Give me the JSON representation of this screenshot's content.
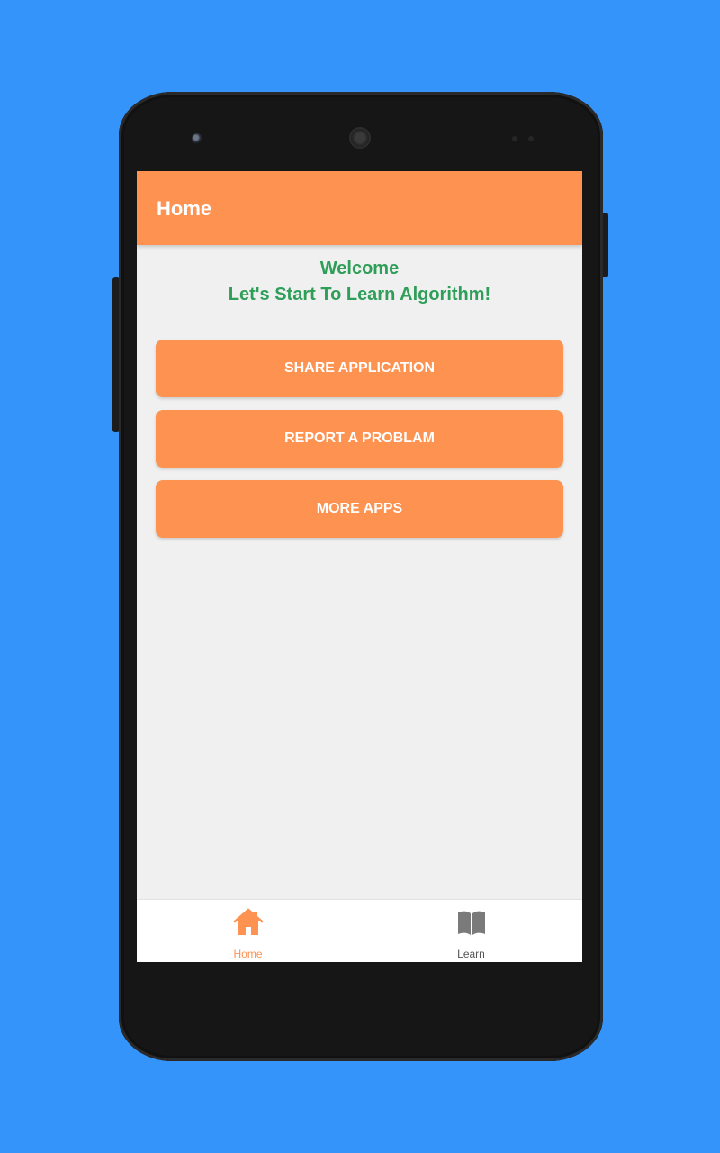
{
  "app": {
    "title": "Home"
  },
  "main": {
    "welcome_line1": "Welcome",
    "welcome_line2": "Let's Start To Learn Algorithm!",
    "buttons": [
      {
        "label": "SHARE APPLICATION"
      },
      {
        "label": "REPORT A PROBLAM"
      },
      {
        "label": "MORE APPS"
      }
    ]
  },
  "bottom_nav": {
    "items": [
      {
        "label": "Home",
        "icon": "home-icon",
        "active": true
      },
      {
        "label": "Learn",
        "icon": "book-icon",
        "active": false
      }
    ]
  },
  "colors": {
    "background": "#3494fa",
    "accent": "#fe9250",
    "welcome_text": "#2e9e58",
    "screen_bg": "#f0f0f0",
    "inactive_icon": "#7a7a7a"
  }
}
